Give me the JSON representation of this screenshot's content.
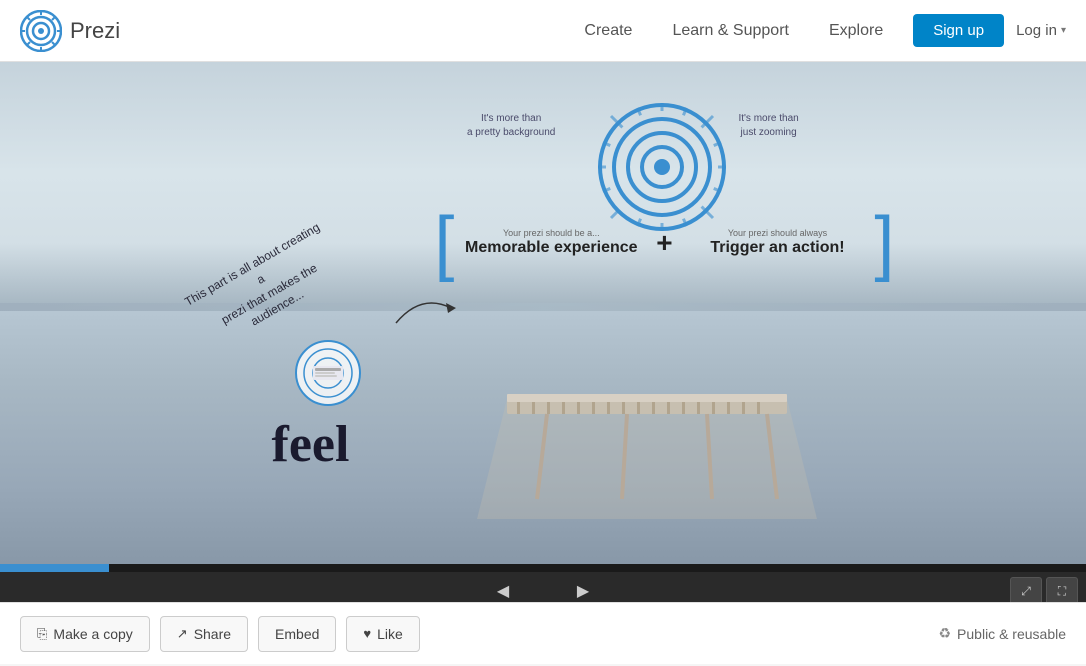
{
  "header": {
    "logo_text": "Prezi",
    "nav": {
      "create": "Create",
      "learn_support": "Learn & Support",
      "explore": "Explore"
    },
    "signup_label": "Sign up",
    "login_label": "Log in"
  },
  "presentation": {
    "canvas": {
      "info_text_1_line1": "It's more than",
      "info_text_1_line2": "a pretty background",
      "info_text_2_line1": "It's more than",
      "info_text_2_line2": "just zooming",
      "bracket_item1_sub": "Your prezi should be a...",
      "bracket_item1_main": "Memorable experience",
      "bracket_item2_sub": "Your prezi should always",
      "bracket_item2_main": "Trigger an action!",
      "feel_text": "feel",
      "angled_text_1": "This part is all about creating a",
      "angled_text_2": "prezi that makes the audience..."
    },
    "controls": {
      "prev_arrow": "◀",
      "next_arrow": "▶"
    }
  },
  "footer": {
    "make_copy_label": "Make a copy",
    "share_label": "Share",
    "embed_label": "Embed",
    "like_label": "Like",
    "public_label": "Public & reusable"
  }
}
